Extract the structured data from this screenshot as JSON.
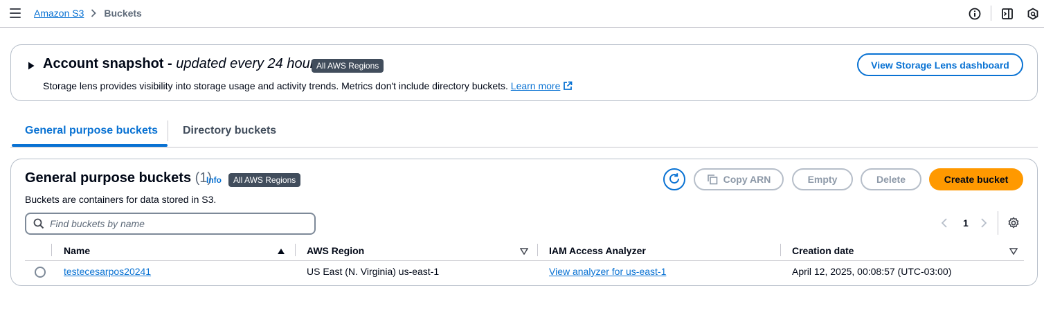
{
  "topbar": {
    "breadcrumb": [
      {
        "label": "Amazon S3"
      },
      {
        "label": "Buckets"
      }
    ],
    "icons": [
      "menu-icon",
      "info-icon",
      "panel-icon",
      "hexagon-icon"
    ]
  },
  "snapshot": {
    "title": "Account snapshot - ",
    "title_italic": "updated every 24 hours",
    "badge": "All AWS Regions",
    "description": "Storage lens provides visibility into storage usage and activity trends. Metrics don't include directory buckets. ",
    "learn_more": "Learn more",
    "button": "View Storage Lens dashboard"
  },
  "tabs": [
    {
      "label": "General purpose buckets",
      "active": true
    },
    {
      "label": "Directory buckets",
      "active": false
    }
  ],
  "buckets_panel": {
    "title": "General purpose buckets",
    "count": "(1)",
    "info": "Info",
    "badge": "All AWS Regions",
    "description": "Buckets are containers for data stored in S3.",
    "buttons": {
      "copy_arn": "Copy ARN",
      "empty": "Empty",
      "delete": "Delete",
      "create": "Create bucket"
    },
    "search_placeholder": "Find buckets by name",
    "pagination": {
      "current_page": "1"
    },
    "columns": [
      "Name",
      "AWS Region",
      "IAM Access Analyzer",
      "Creation date"
    ],
    "rows": [
      {
        "name": "testecesarpos20241",
        "region": "US East (N. Virginia) us-east-1",
        "analyzer": "View analyzer for us-east-1",
        "creation_date": "April 12, 2025, 00:08:57 (UTC-03:00)"
      }
    ]
  },
  "colors": {
    "link": "#0972d3",
    "primary_button": "#ff9900",
    "badge": "#414d5c",
    "border": "#b6bec9"
  }
}
